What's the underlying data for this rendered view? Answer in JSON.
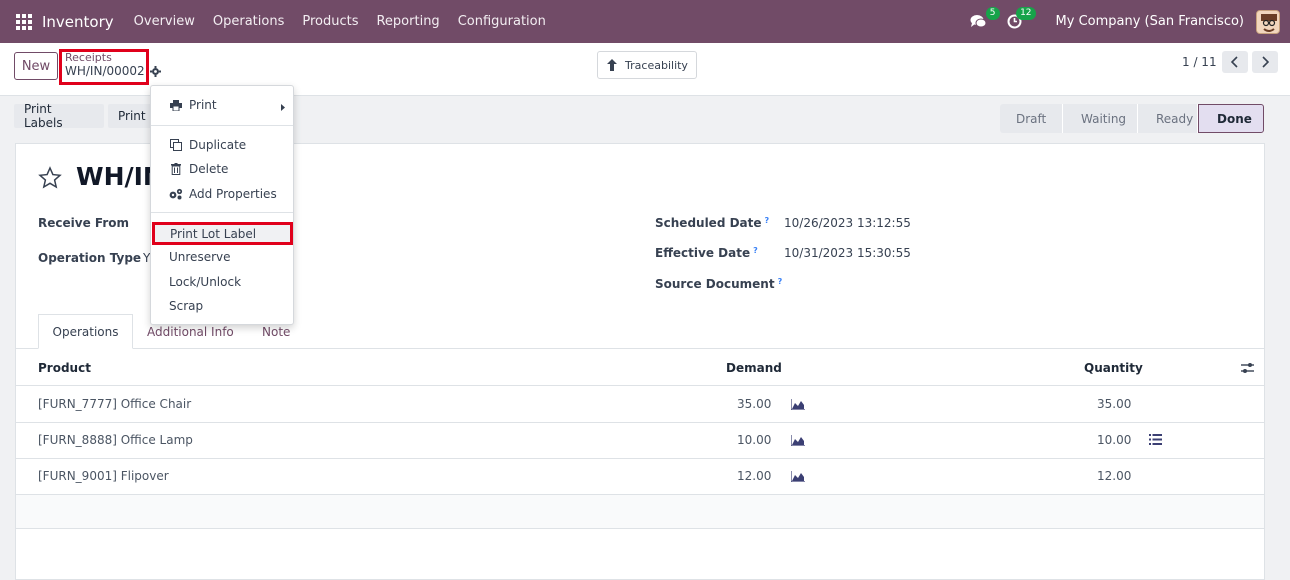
{
  "navbar": {
    "brand": "Inventory",
    "menu": [
      "Overview",
      "Operations",
      "Products",
      "Reporting",
      "Configuration"
    ],
    "chat_count": "5",
    "activity_count": "12",
    "company": "My Company (San Francisco)"
  },
  "control": {
    "new_label": "New",
    "breadcrumb_parent": "Receipts",
    "breadcrumb_current": "WH/IN/00002",
    "traceability_label": "Traceability",
    "pager": "1 / 11"
  },
  "actions": {
    "print_labels": "Print Labels",
    "print": "Print"
  },
  "statusbar": {
    "stages": [
      "Draft",
      "Waiting",
      "Ready",
      "Done"
    ],
    "active": "Done"
  },
  "record": {
    "title": "WH/IN",
    "receive_from_label": "Receive From",
    "operation_type_label": "Operation Type",
    "operation_type_value": "Y",
    "scheduled_date_label": "Scheduled Date",
    "scheduled_date_value": "10/26/2023 13:12:55",
    "effective_date_label": "Effective Date",
    "effective_date_value": "10/31/2023 15:30:55",
    "source_document_label": "Source Document",
    "help_mark": "?"
  },
  "tabs": [
    "Operations",
    "Additional Info",
    "Note"
  ],
  "table": {
    "headers": {
      "product": "Product",
      "demand": "Demand",
      "quantity": "Quantity"
    },
    "rows": [
      {
        "product": "[FURN_7777] Office Chair",
        "demand": "35.00",
        "quantity": "35.00"
      },
      {
        "product": "[FURN_8888] Office Lamp",
        "demand": "10.00",
        "quantity": "10.00"
      },
      {
        "product": "[FURN_9001] Flipover",
        "demand": "12.00",
        "quantity": "12.00"
      }
    ]
  },
  "dropdown": {
    "print": "Print",
    "duplicate": "Duplicate",
    "delete": "Delete",
    "add_properties": "Add Properties",
    "print_lot_label": "Print Lot Label",
    "unreserve": "Unreserve",
    "lock_unlock": "Lock/Unlock",
    "scrap": "Scrap"
  },
  "colors": {
    "brand": "#714b67",
    "highlight": "#e0001b",
    "badge": "#17a34a"
  }
}
